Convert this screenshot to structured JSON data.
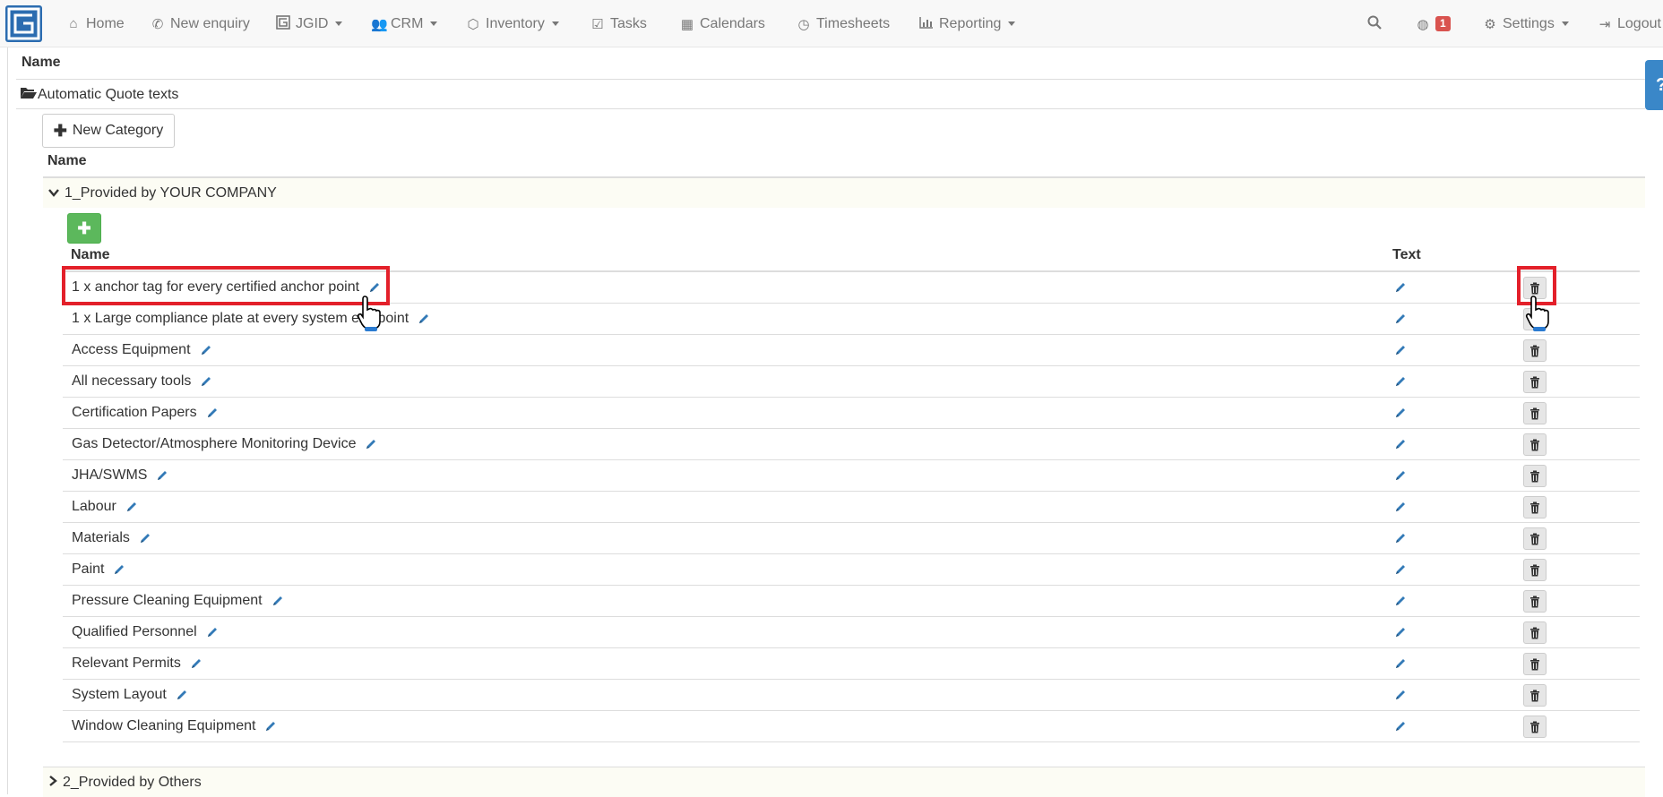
{
  "nav": {
    "home": "Home",
    "new_enquiry": "New enquiry",
    "jgid": "JGID",
    "crm": "CRM",
    "inventory": "Inventory",
    "tasks": "Tasks",
    "calendars": "Calendars",
    "timesheets": "Timesheets",
    "reporting": "Reporting",
    "notifications_count": "1",
    "settings": "Settings",
    "logout": "Logout"
  },
  "table": {
    "header_name": "Name",
    "root_folder": "Automatic Quote texts",
    "new_category_label": "New Category",
    "category_header_name": "Name",
    "item_header_name": "Name",
    "item_header_text": "Text"
  },
  "categories": [
    {
      "label": "1_Provided by YOUR COMPANY",
      "expanded": true
    },
    {
      "label": "2_Provided by Others",
      "expanded": false
    }
  ],
  "items": [
    "1 x anchor tag for every certified anchor point",
    "1 x Large compliance plate at every system exit point",
    "Access Equipment",
    "All necessary tools",
    "Certification Papers",
    "Gas Detector/Atmosphere Monitoring Device",
    "JHA/SWMS",
    "Labour",
    "Materials",
    "Paint",
    "Pressure Cleaning Equipment",
    "Qualified Personnel",
    "Relevant Permits",
    "System Layout",
    "Window Cleaning Equipment"
  ],
  "colors": {
    "accent": "#2b6cb0",
    "success": "#5cb85c",
    "highlight": "#e3202a",
    "badge": "#d9534f"
  }
}
